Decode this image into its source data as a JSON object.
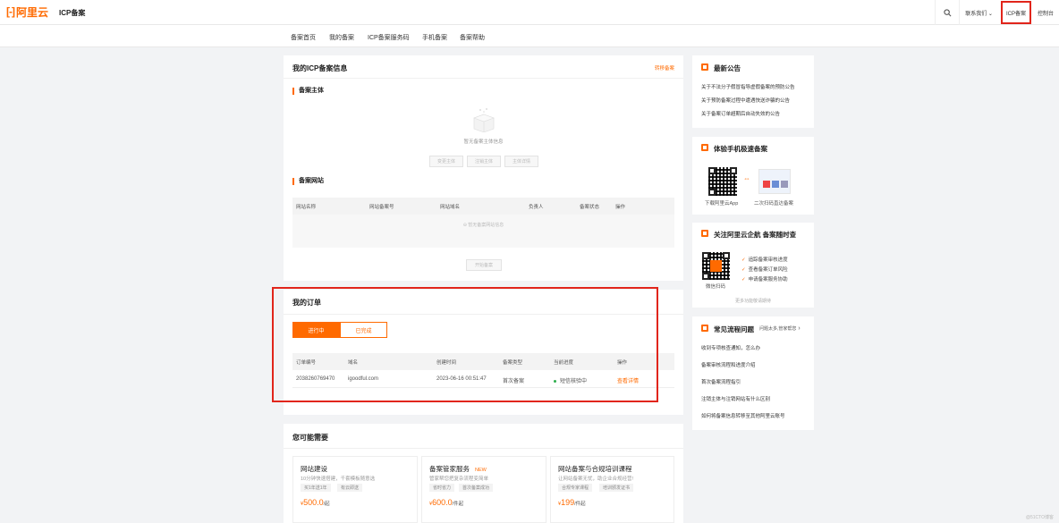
{
  "header": {
    "logo_text": "阿里云",
    "site_title": "ICP备案",
    "contact_label": "联系我们",
    "icp_label": "ICP备案",
    "console_label": "控制台"
  },
  "subnav": [
    "备案首页",
    "我的备案",
    "ICP备案服务码",
    "手机备案",
    "备案帮助"
  ],
  "info": {
    "title": "我的ICP备案信息",
    "transfer_link": "转移备案",
    "subject_label": "备案主体",
    "empty_subject": "暂无备案主体信息",
    "subject_buttons": [
      "变更主体",
      "注销主体",
      "主体详情"
    ],
    "site_label": "备案网站",
    "site_columns": [
      "网站名称",
      "网站备案号",
      "网站域名",
      "负责人",
      "备案状态",
      "操作"
    ],
    "empty_site": "暂无备案网站信息",
    "start_button": "开始备案"
  },
  "orders": {
    "title": "我的订单",
    "tabs": [
      "进行中",
      "已完成"
    ],
    "columns": [
      "订单编号",
      "域名",
      "创建时间",
      "备案类型",
      "当前进度",
      "操作"
    ],
    "rows": [
      {
        "id": "2038260769470",
        "domain": "igoodful.com",
        "created": "2023-06-16 00:51:47",
        "type": "首次备案",
        "progress": "短信核验中",
        "action": "查看详情"
      }
    ]
  },
  "recommend": {
    "title": "您可能需要",
    "items": [
      {
        "title": "网站建设",
        "badge": "",
        "subtitle": "10分钟快速搭建，千套模板随意选",
        "tags": [
          "买1年送1年",
          "有云即送"
        ],
        "price": "500.0",
        "unit": "/起"
      },
      {
        "title": "备案管家服务",
        "badge": "NEW",
        "subtitle": "管家帮您把复杂流程变简单",
        "tags": [
          "省时省力",
          "首次备案成功"
        ],
        "price": "600.0",
        "unit": "/件起"
      },
      {
        "title": "网站备案与合规培训课程",
        "badge": "",
        "subtitle": "让网站备案无忧，助企业合规经营!",
        "tags": [
          "合规专家课程",
          "培训颁发证书"
        ],
        "price": "199",
        "unit": "/件起"
      }
    ],
    "currency": "¥"
  },
  "sidebar": {
    "notice_title": "最新公告",
    "notices": [
      "关于不法分子假冒指导虚假备案的预防公告",
      "关于预防备案过程中遭遇快送诈骗的公告",
      "关于备案订单超期后自动失效的公告"
    ],
    "mobile_title": "体验手机极速备案",
    "mobile_captions": [
      "下载阿里云App",
      "二次扫码直达备案"
    ],
    "follow_title": "关注阿里云企航 备案随时查",
    "follow_items": [
      "追踪备案审核进度",
      "查看备案订单风险",
      "申请备案服务协助"
    ],
    "follow_caption": "微信扫码",
    "follow_more": "更多功能敬请期待",
    "faq_title": "常见流程问题",
    "faq_more": "问题太多,管家帮您",
    "faqs": [
      "收到专项核查通知，怎么办",
      "备案审核流程和进度介绍",
      "首次备案流程指引",
      "注销主体与注销网站有什么区别",
      "如何将备案信息转移至其他阿里云账号"
    ]
  },
  "watermark": "@51CTO博客",
  "colors": {
    "accent": "#ff6a00",
    "highlight": "#e1251b",
    "status_dot": "#2eaf4d"
  }
}
